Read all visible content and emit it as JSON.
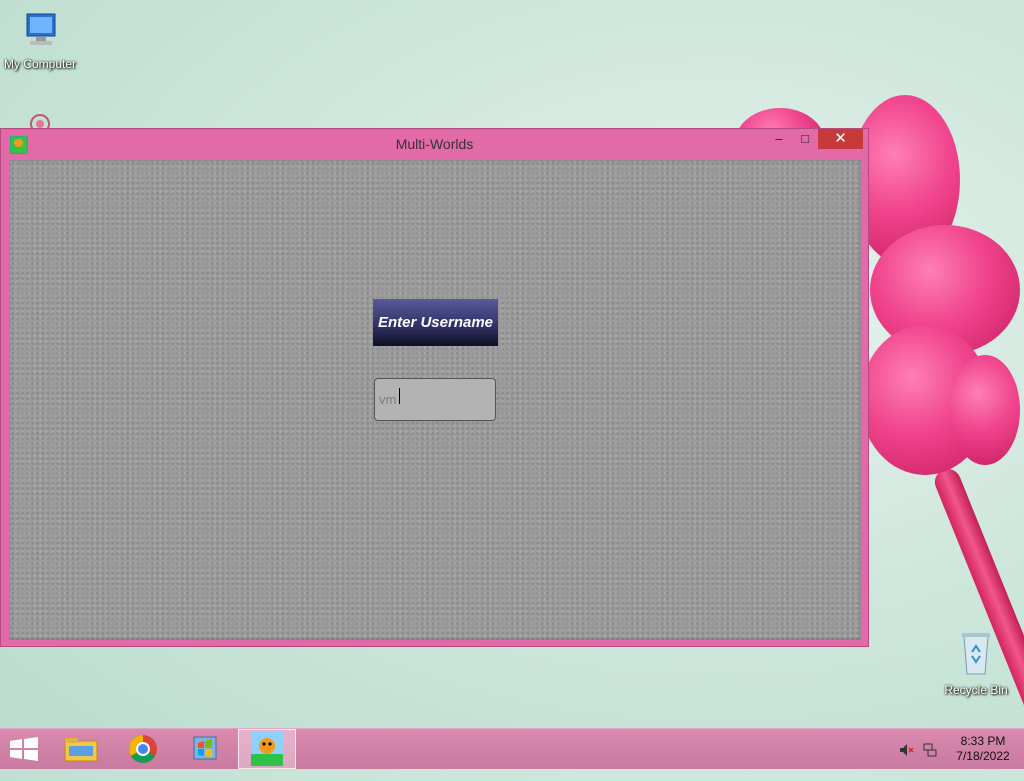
{
  "desktop": {
    "icons": [
      {
        "label": "My Computer"
      },
      {
        "label": "Recycle Bin"
      }
    ]
  },
  "window": {
    "title": "Multi-Worlds",
    "controls": {
      "minimize": "‒",
      "maximize": "□",
      "close": "✕"
    },
    "prompt_label": "Enter Username",
    "username_input": {
      "value": "vm",
      "placeholder": ""
    }
  },
  "taskbar": {
    "items": [
      "start",
      "file-explorer",
      "chrome",
      "windows-media",
      "multi-worlds-app"
    ],
    "active_item": "multi-worlds-app",
    "clock": {
      "time": "8:33 PM",
      "date": "7/18/2022"
    },
    "tray": [
      "volume-muted-icon",
      "network-icon"
    ]
  },
  "colors": {
    "window_frame": "#e36aa8",
    "close_button": "#c83a3a",
    "content_bg": "#9b9b9b",
    "label_bg": "#33336a"
  }
}
